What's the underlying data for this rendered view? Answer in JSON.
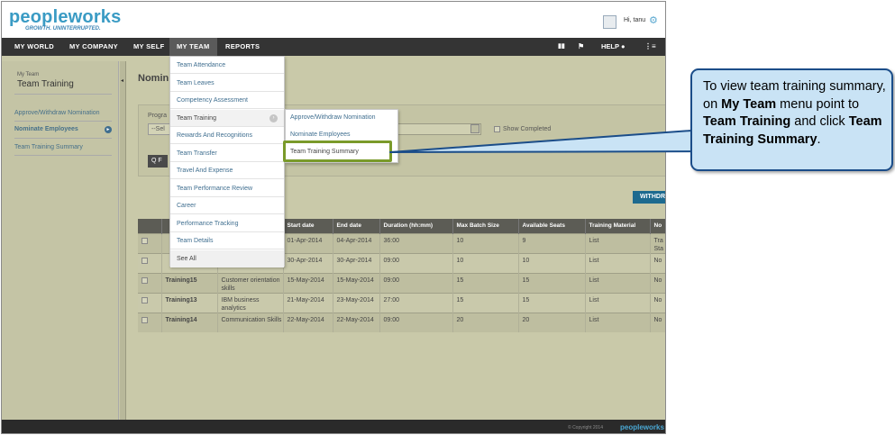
{
  "header": {
    "logo": "peopleworks",
    "tagline": "GROWTH. UNINTERRUPTED.",
    "greeting": "Hi, tanu"
  },
  "nav": {
    "items": [
      {
        "label": "MY WORLD"
      },
      {
        "label": "MY COMPANY"
      },
      {
        "label": "MY SELF"
      },
      {
        "label": "MY TEAM"
      },
      {
        "label": "REPORTS"
      }
    ],
    "help": "HELP"
  },
  "sidebar": {
    "subtitle": "My Team",
    "title": "Team Training",
    "links": [
      {
        "label": "Approve/Withdraw Nomination"
      },
      {
        "label": "Nominate Employees"
      },
      {
        "label": "Team Training Summary"
      }
    ]
  },
  "page": {
    "heading": "Nomin",
    "filter_label": "Progra",
    "select_value": "--Sel",
    "show_completed": "Show Completed",
    "search_label": "Q F",
    "withdraw_label": "WITHDR"
  },
  "table": {
    "columns": [
      "",
      "",
      "",
      "Start date",
      "End date",
      "Duration (hh:mm)",
      "Max Batch Size",
      "Available Seats",
      "Training Material",
      "No"
    ],
    "rows": [
      {
        "name": "",
        "desc": "",
        "start": "01-Apr-2014",
        "end": "04-Apr-2014",
        "duration": "36:00",
        "max": "10",
        "seats": "9",
        "material": "List",
        "note": "Tra Sta"
      },
      {
        "name": "",
        "desc": "",
        "start": "30-Apr-2014",
        "end": "30-Apr-2014",
        "duration": "09:00",
        "max": "10",
        "seats": "10",
        "material": "List",
        "note": "No"
      },
      {
        "name": "Training15",
        "desc": "Customer orientation skills",
        "start": "15-May-2014",
        "end": "15-May-2014",
        "duration": "09:00",
        "max": "15",
        "seats": "15",
        "material": "List",
        "note": "No"
      },
      {
        "name": "Training13",
        "desc": "IBM business analytics",
        "start": "21-May-2014",
        "end": "23-May-2014",
        "duration": "27:00",
        "max": "15",
        "seats": "15",
        "material": "List",
        "note": "No"
      },
      {
        "name": "Training14",
        "desc": "Communication Skills",
        "start": "22-May-2014",
        "end": "22-May-2014",
        "duration": "09:00",
        "max": "20",
        "seats": "20",
        "material": "List",
        "note": "No"
      }
    ]
  },
  "dropdown": {
    "items": [
      {
        "label": "Team Attendance"
      },
      {
        "label": "Team Leaves"
      },
      {
        "label": "Competency Assessment"
      },
      {
        "label": "Team Training"
      },
      {
        "label": "Rewards And Recognitions"
      },
      {
        "label": "Team Transfer"
      },
      {
        "label": "Travel And Expense"
      },
      {
        "label": "Team Performance Review"
      },
      {
        "label": "Career"
      },
      {
        "label": "Performance Tracking"
      },
      {
        "label": "Team Details"
      },
      {
        "label": "See All"
      }
    ]
  },
  "submenu": {
    "items": [
      {
        "label": "Approve/Withdraw Nomination"
      },
      {
        "label": "Nominate Employees"
      },
      {
        "label": "Team Training Summary"
      }
    ]
  },
  "footer": {
    "copyright": "© Copyright 2014",
    "logo": "peopleworks"
  },
  "callout": {
    "t1": "To view team training summary, on ",
    "b1": "My Team",
    "t2": " menu point to ",
    "b2": "Team Training",
    "t3": " and click ",
    "b3": "Team Training Summary",
    "t4": "."
  },
  "colors": {
    "accent": "#3a9bc4",
    "navbar": "#343434",
    "overlay": "#c9c9a9",
    "callout_bg": "#c9e3f5",
    "callout_border": "#1b4d89",
    "highlight": "#7a9a2a"
  }
}
